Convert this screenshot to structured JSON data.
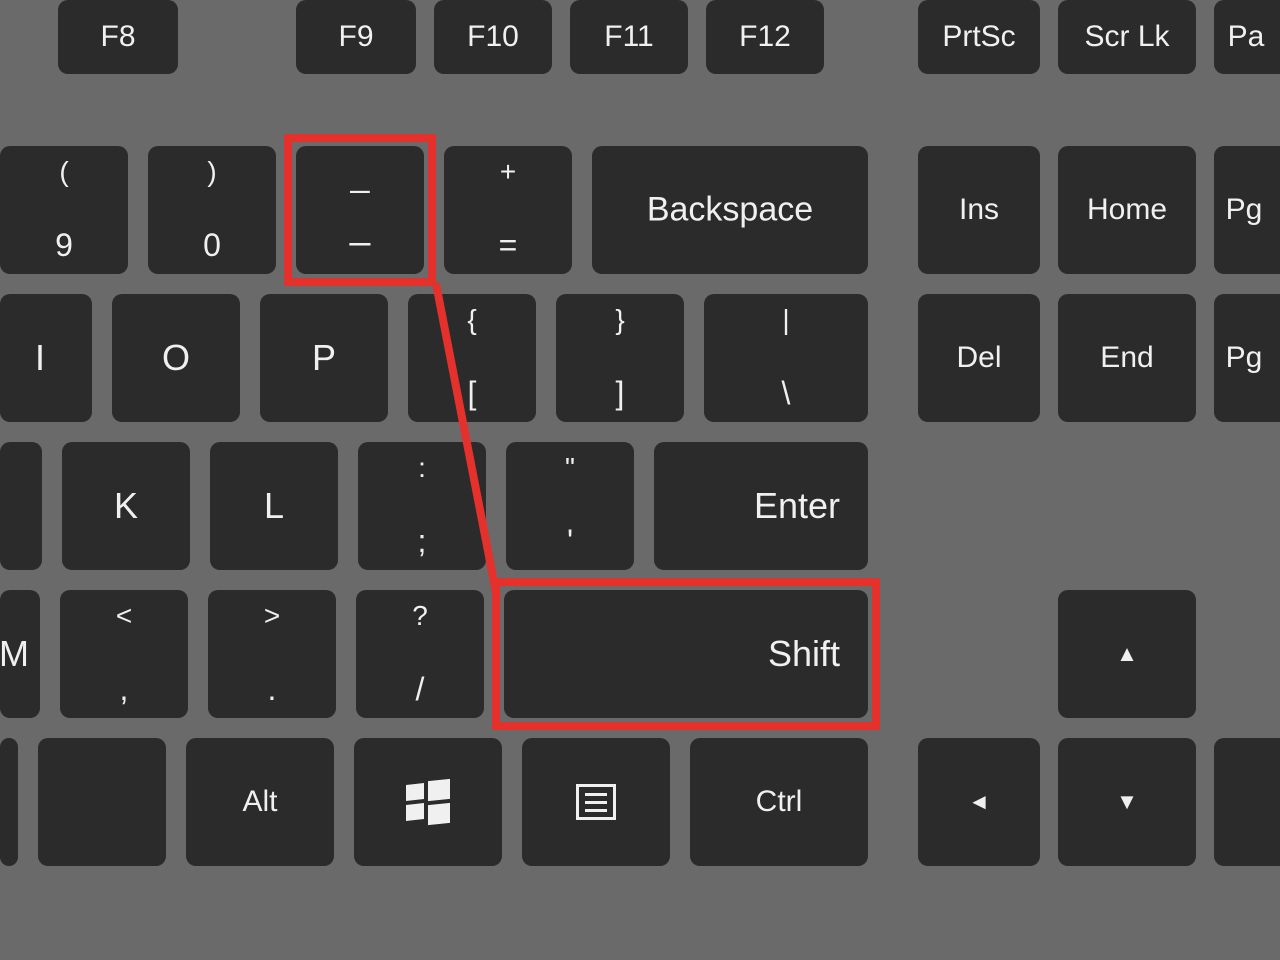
{
  "row0": {
    "f8": "F8",
    "f9": "F9",
    "f10": "F10",
    "f11": "F11",
    "f12": "F12",
    "prtsc": "PrtSc",
    "scrlk": "Scr Lk",
    "pa": "Pa"
  },
  "row1": {
    "nine_top": "(",
    "nine_bottom": "9",
    "zero_top": ")",
    "zero_bottom": "0",
    "minus_top": "_",
    "minus_bottom": "–",
    "equals_top": "+",
    "equals_bottom": "=",
    "backspace": "Backspace",
    "ins": "Ins",
    "home": "Home",
    "pg": "Pg"
  },
  "row2": {
    "i": "I",
    "o": "O",
    "p": "P",
    "lbracket_top": "{",
    "lbracket_bottom": "[",
    "rbracket_top": "}",
    "rbracket_bottom": "]",
    "backslash_top": "|",
    "backslash_bottom": "\\",
    "del": "Del",
    "end": "End",
    "pg": "Pg"
  },
  "row3": {
    "k": "K",
    "l": "L",
    "semi_top": ":",
    "semi_bottom": ";",
    "quote_top": "\"",
    "quote_bottom": "'",
    "enter": "Enter"
  },
  "row4": {
    "m": "M",
    "comma_top": "<",
    "comma_bottom": ",",
    "period_top": ">",
    "period_bottom": ".",
    "slash_top": "?",
    "slash_bottom": "/",
    "shift": "Shift",
    "up": "▲"
  },
  "row5": {
    "alt": "Alt",
    "ctrl": "Ctrl",
    "left": "◄",
    "down": "▼"
  },
  "annotation": {
    "highlighted_keys": [
      "minus-key",
      "shift-key"
    ],
    "relation": "Shift + Minus produces underscore"
  }
}
